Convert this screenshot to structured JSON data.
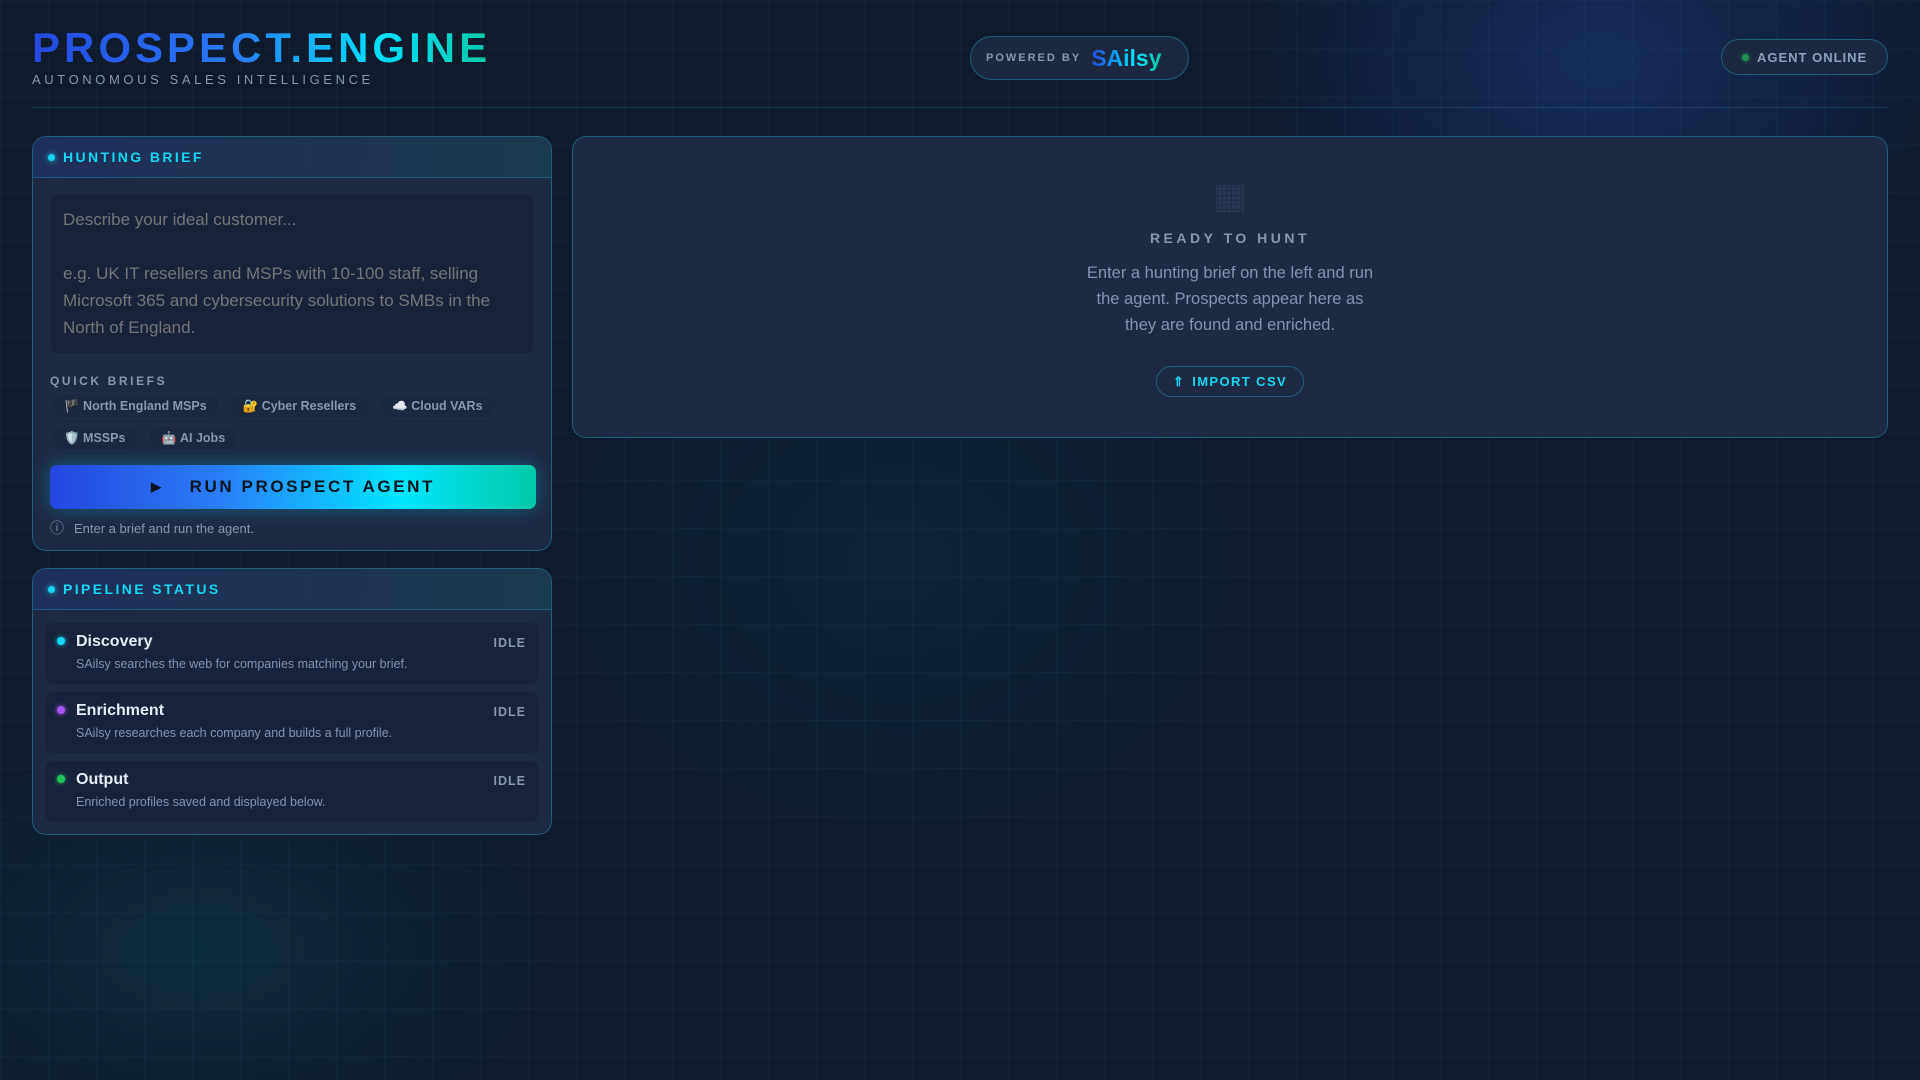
{
  "header": {
    "title": "PROSPECT.ENGINE",
    "subtitle": "AUTONOMOUS SALES INTELLIGENCE",
    "powered_by": "POWERED BY",
    "brand": "SAilsy",
    "status": "AGENT ONLINE"
  },
  "brief": {
    "title": "HUNTING BRIEF",
    "placeholder": "Describe your ideal customer...\n\ne.g. UK IT resellers and MSPs with 10-100 staff, selling Microsoft 365 and cybersecurity solutions to SMBs in the North of England.",
    "value": "",
    "quick_label": "QUICK BRIEFS",
    "chips": [
      {
        "label": "🏴 North England MSPs"
      },
      {
        "label": "🔐 Cyber Resellers"
      },
      {
        "label": "☁️ Cloud VARs"
      },
      {
        "label": "🛡️ MSSPs"
      },
      {
        "label": "🤖 AI Jobs"
      }
    ],
    "run_icon": "▶",
    "run_label": "RUN PROSPECT AGENT",
    "hint_icon": "ⓘ",
    "hint": "Enter a brief and run the agent."
  },
  "pipeline": {
    "title": "PIPELINE STATUS",
    "stages": [
      {
        "name": "Discovery",
        "desc": "SAilsy searches the web for companies matching your brief.",
        "state": "IDLE",
        "color": "#14d6f5"
      },
      {
        "name": "Enrichment",
        "desc": "SAilsy researches each company and builds a full profile.",
        "state": "IDLE",
        "color": "#a855f7"
      },
      {
        "name": "Output",
        "desc": "Enriched profiles saved and displayed below.",
        "state": "IDLE",
        "color": "#22c55e"
      }
    ]
  },
  "results": {
    "icon": "grid-icon",
    "title": "READY TO HUNT",
    "text": "Enter a hunting brief on the left and run the agent. Prospects appear here as they are found and enriched.",
    "import_icon": "⇑",
    "import_label": "IMPORT CSV"
  }
}
